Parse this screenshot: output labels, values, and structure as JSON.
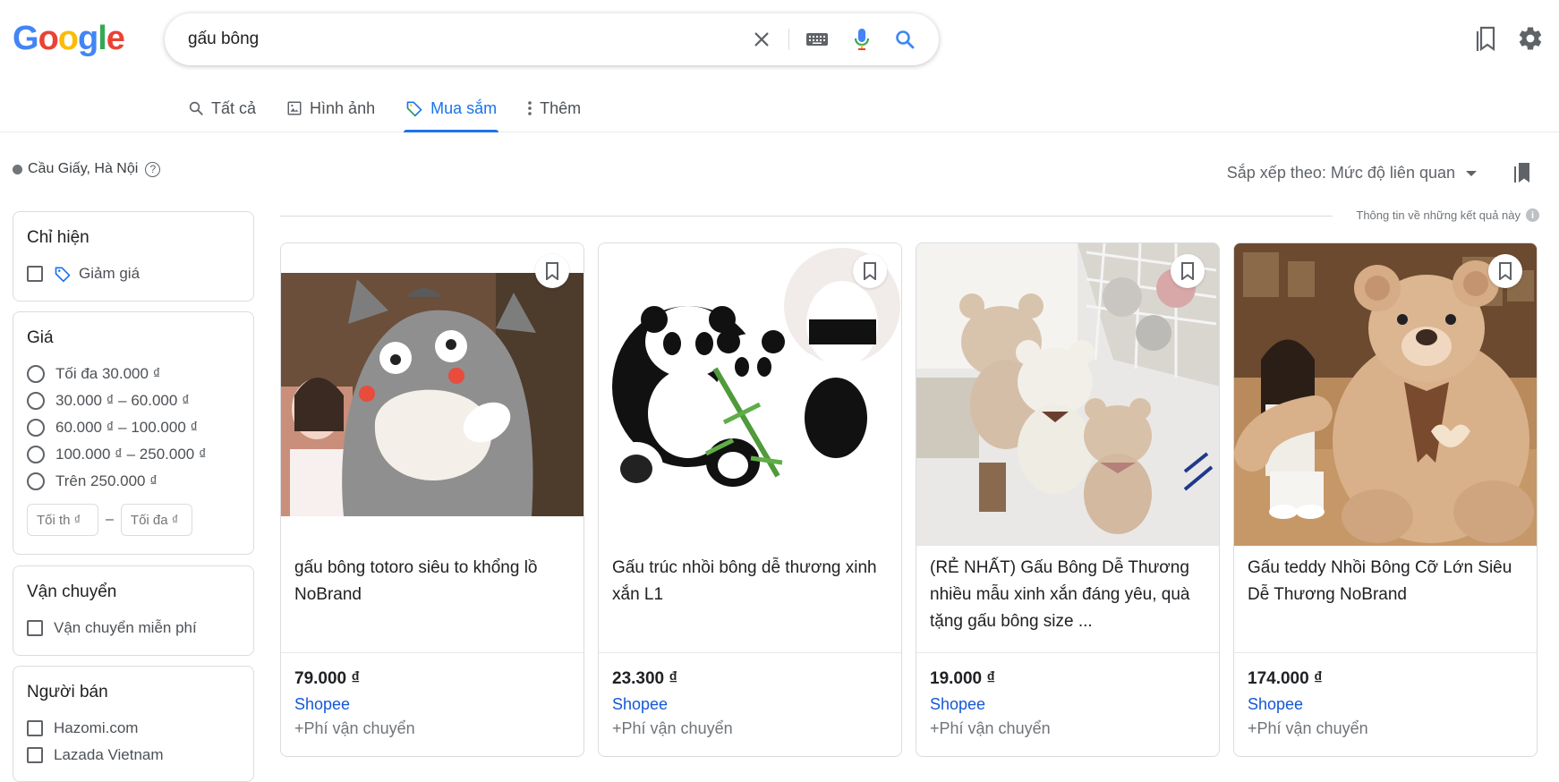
{
  "logo": {
    "letters": [
      "G",
      "o",
      "o",
      "g",
      "l",
      "e"
    ],
    "colors": [
      "#4285F4",
      "#EA4335",
      "#FBBC05",
      "#4285F4",
      "#34A853",
      "#EA4335"
    ]
  },
  "search": {
    "value": "gấu bông"
  },
  "tabs": [
    {
      "label": "Tất cả",
      "icon": "search-icon"
    },
    {
      "label": "Hình ảnh",
      "icon": "image-icon"
    },
    {
      "label": "Mua sắm",
      "icon": "tag-icon",
      "active": true
    },
    {
      "label": "Thêm",
      "icon": "more-vert-icon"
    }
  ],
  "location": {
    "text": "Cầu Giấy, Hà Nội",
    "help": "?"
  },
  "sort": {
    "label": "Sắp xếp theo: Mức độ liên quan"
  },
  "results_info": {
    "text": "Thông tin về những kết quả này",
    "icon": "i"
  },
  "filters": {
    "show_only": {
      "title": "Chỉ hiện",
      "option": "Giảm giá"
    },
    "price": {
      "title": "Giá",
      "options": [
        "Tối đa 30.000 ₫",
        "30.000 ₫ – 60.000 ₫",
        "60.000 ₫ – 100.000 ₫",
        "100.000 ₫ – 250.000 ₫",
        "Trên 250.000 ₫"
      ],
      "min_placeholder": "Tối th ₫",
      "max_placeholder": "Tối đa ₫",
      "dash": "–"
    },
    "shipping": {
      "title": "Vận chuyển",
      "option": "Vận chuyển miễn phí"
    },
    "sellers": {
      "title": "Người bán",
      "options": [
        "Hazomi.com",
        "Lazada Vietnam"
      ]
    }
  },
  "products": [
    {
      "title": "gấu bông totoro siêu to khổng lồ NoBrand",
      "price": "79.000 ₫",
      "store": "Shopee",
      "shipping": "+Phí vận chuyển"
    },
    {
      "title": "Gấu trúc nhồi bông dễ thương xinh xắn L1",
      "price": "23.300 ₫",
      "store": "Shopee",
      "shipping": "+Phí vận chuyển"
    },
    {
      "title": "(RẺ NHẤT) Gấu Bông Dễ Thương nhiều mẫu xinh xắn đáng yêu, quà tặng gấu bông size ...",
      "price": "19.000 ₫",
      "store": "Shopee",
      "shipping": "+Phí vận chuyển"
    },
    {
      "title": "Gấu teddy Nhồi Bông Cỡ Lớn Siêu Dễ Thương NoBrand",
      "price": "174.000 ₫",
      "store": "Shopee",
      "shipping": "+Phí vận chuyển"
    }
  ]
}
